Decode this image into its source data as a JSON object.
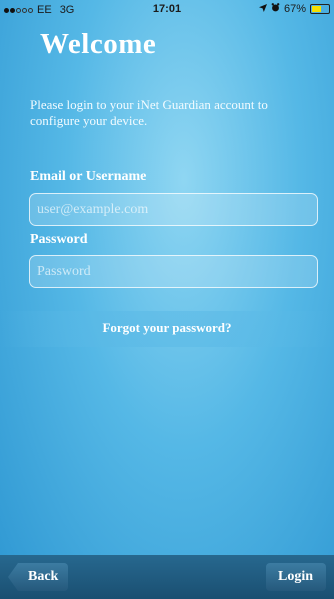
{
  "status_bar": {
    "carrier": "EE",
    "network": "3G",
    "time": "17:01",
    "battery": "67%",
    "battery_level": 0.67,
    "battery_color": "#f6e000",
    "icons": [
      "signal-dots-icon",
      "location-arrow-icon",
      "alarm-icon",
      "battery-icon"
    ]
  },
  "login": {
    "title": "Welcome",
    "intro": "Please login to your iNet Guardian account to configure your device.",
    "email_label": "Email or Username",
    "email_value": "",
    "email_placeholder": "user@example.com",
    "password_label": "Password",
    "password_value": "",
    "password_placeholder": "Password",
    "forgot_link": "Forgot your password?"
  },
  "bottom_bar": {
    "back_label": "Back",
    "login_label": "Login"
  },
  "colors": {
    "background_accent": "#55b8e6",
    "bar": "#1a4f71",
    "text": "#ffffff"
  }
}
